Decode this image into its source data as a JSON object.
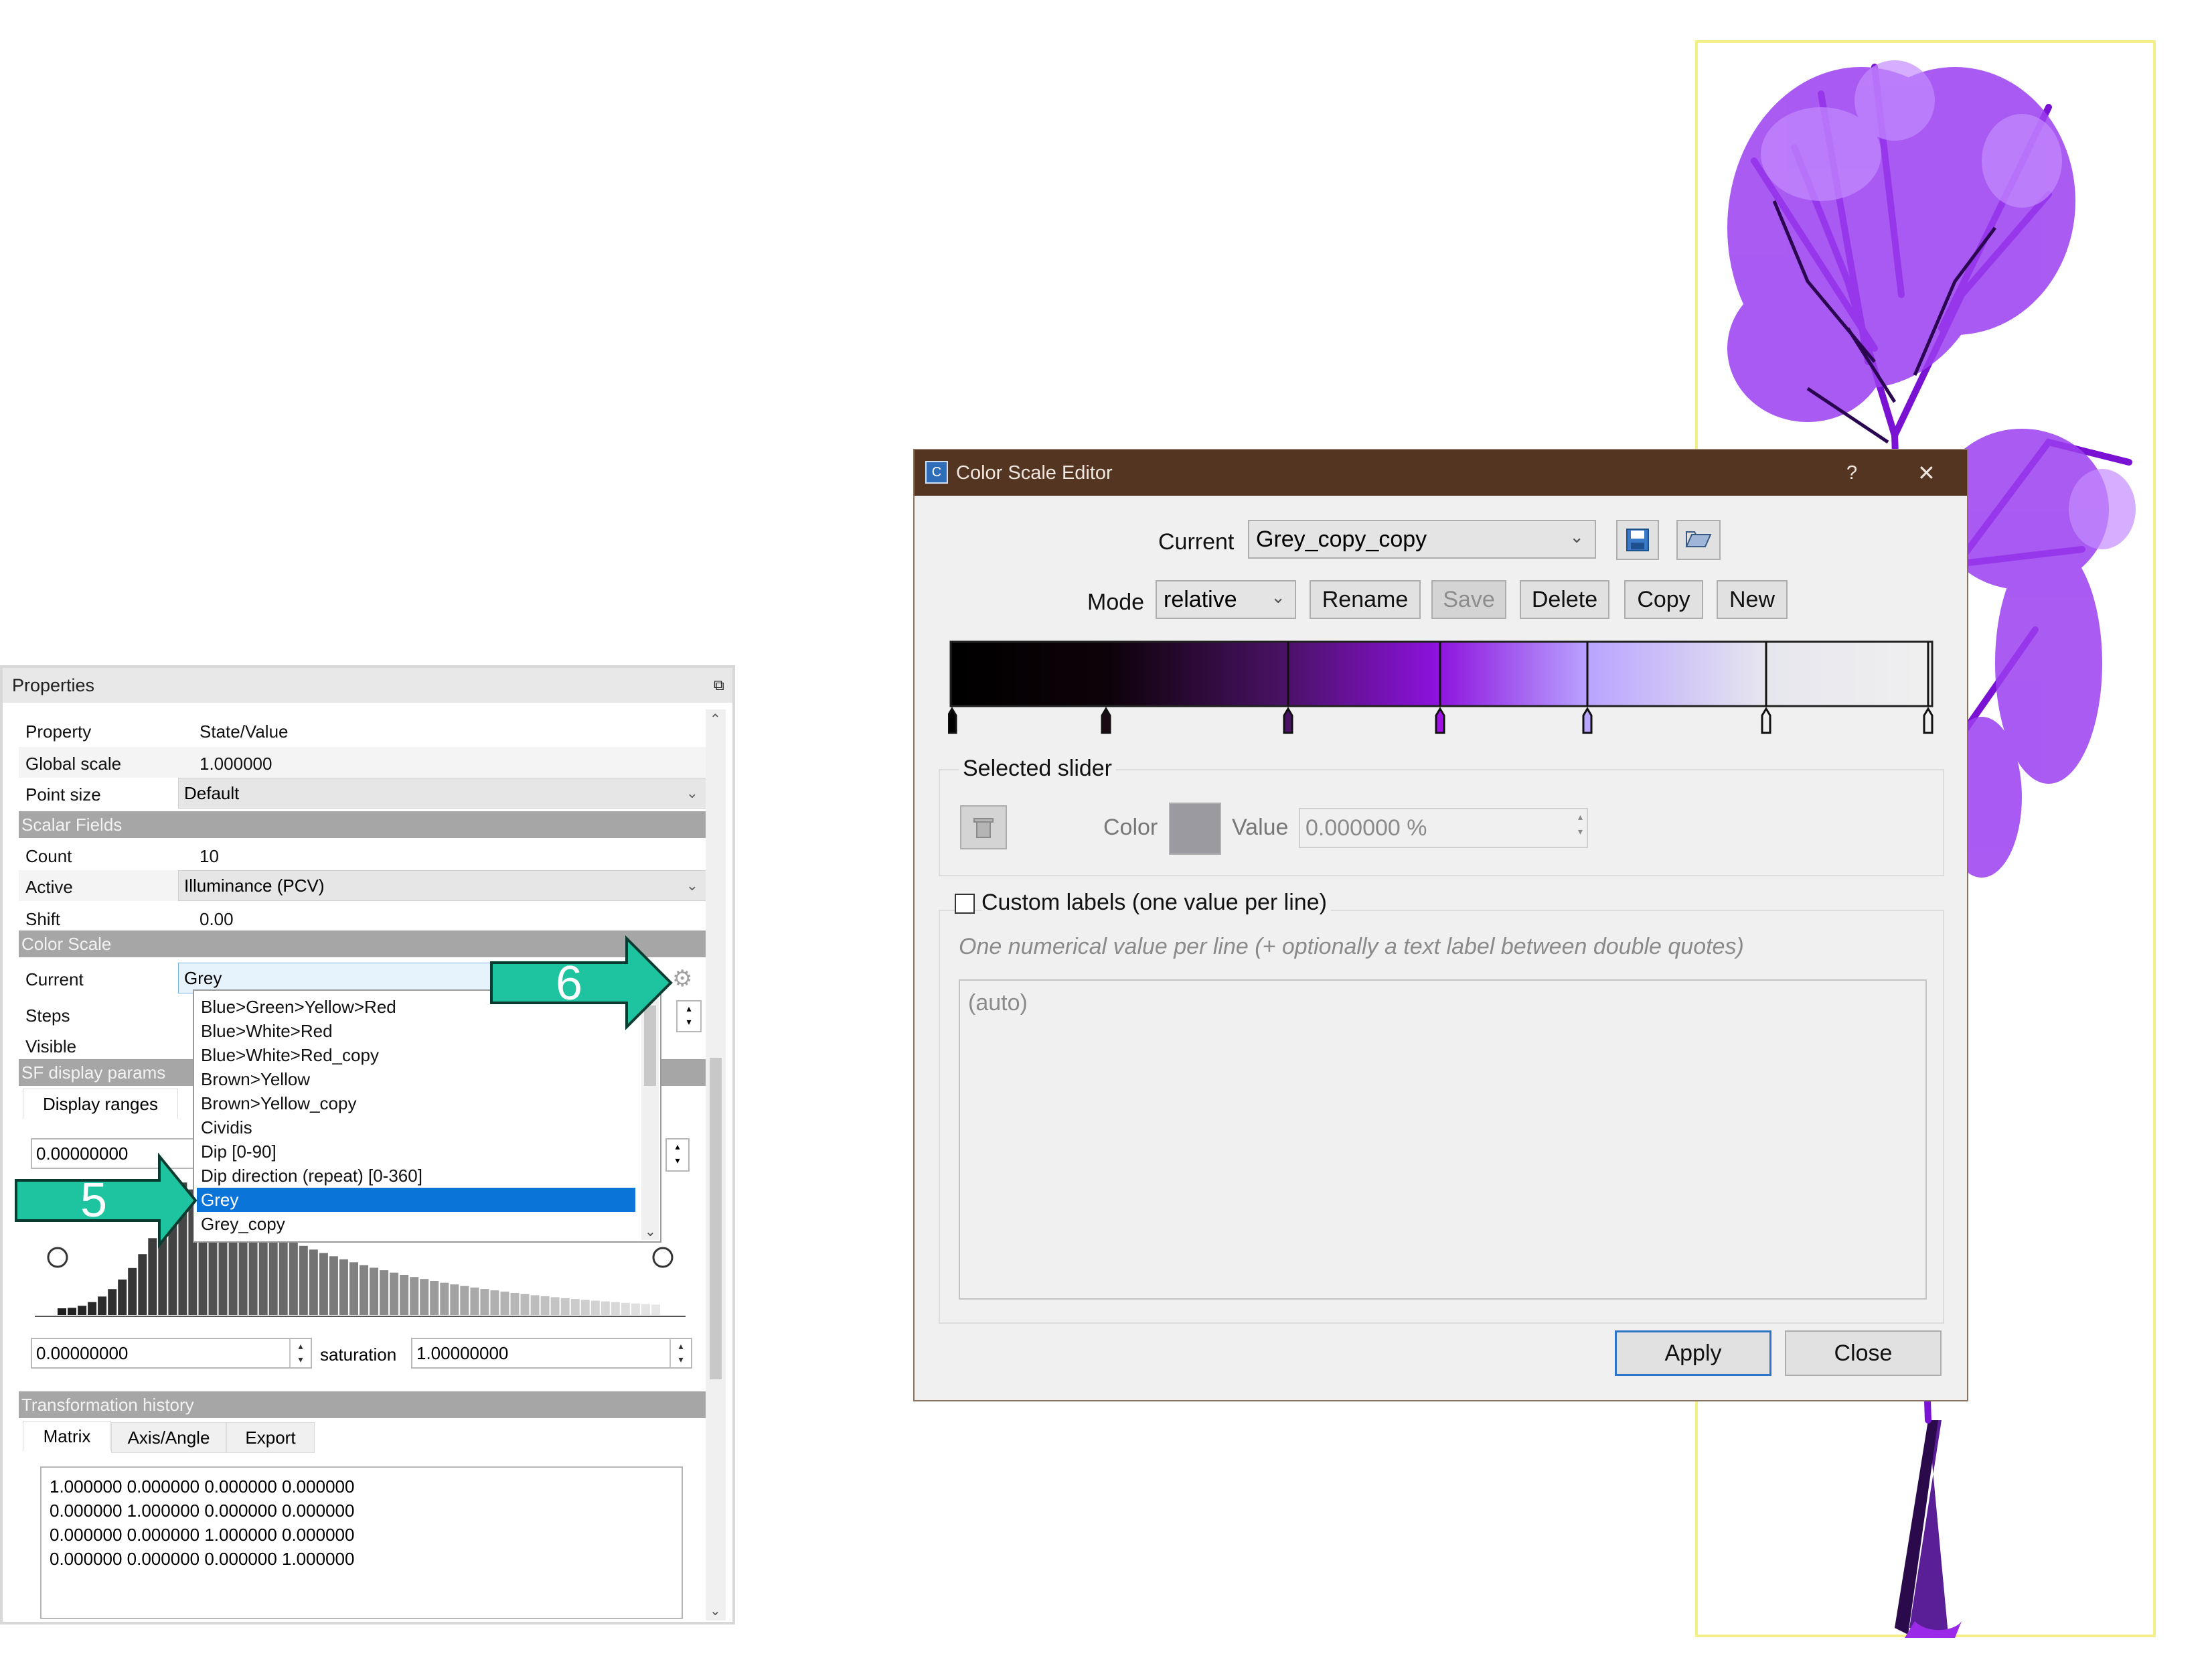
{
  "properties": {
    "title": "Properties",
    "header": {
      "property": "Property",
      "value": "State/Value"
    },
    "global_scale": {
      "label": "Global scale",
      "value": "1.000000"
    },
    "point_size": {
      "label": "Point size",
      "value": "Default"
    },
    "scalar_fields": {
      "section": "Scalar Fields",
      "count": {
        "label": "Count",
        "value": "10"
      },
      "active": {
        "label": "Active",
        "value": "Illuminance (PCV)"
      },
      "shift": {
        "label": "Shift",
        "value": "0.00"
      }
    },
    "color_scale": {
      "section": "Color Scale",
      "current": {
        "label": "Current",
        "value": "Grey"
      },
      "steps": {
        "label": "Steps"
      },
      "visible": {
        "label": "Visible"
      }
    },
    "sf_display": {
      "section": "SF display params",
      "tab": "Display ranges",
      "min_value": "0.00000000",
      "low_value": "0.00000000",
      "saturation_label": "saturation",
      "saturation_value": "1.00000000"
    },
    "transformation": {
      "section": "Transformation history",
      "tabs": [
        "Matrix",
        "Axis/Angle",
        "Export"
      ],
      "matrix": [
        "1.000000 0.000000 0.000000 0.000000",
        "0.000000 1.000000 0.000000 0.000000",
        "0.000000 0.000000 1.000000 0.000000",
        "0.000000 0.000000 0.000000 1.000000"
      ]
    },
    "dropdown_items": [
      "Blue>Green>Yellow>Red",
      "Blue>White>Red",
      "Blue>White>Red_copy",
      "Brown>Yellow",
      "Brown>Yellow_copy",
      "Cividis",
      "Dip [0-90]",
      "Dip direction (repeat) [0-360]",
      "Grey",
      "Grey_copy"
    ],
    "dropdown_selected": "Grey"
  },
  "annotations": {
    "arrow5": "5",
    "arrow6": "6",
    "arrow_color": "#1ec4a0"
  },
  "dialog": {
    "title": "Color Scale Editor",
    "help": "?",
    "close": "✕",
    "current_label": "Current",
    "current_value": "Grey_copy_copy",
    "mode_label": "Mode",
    "mode_value": "relative",
    "buttons": {
      "rename": "Rename",
      "save": "Save",
      "delete": "Delete",
      "copy": "Copy",
      "new": "New"
    },
    "selected_slider": {
      "title": "Selected slider",
      "color_label": "Color",
      "value_label": "Value",
      "value": "0.000000 %"
    },
    "custom_labels": {
      "checkbox": "Custom labels (one value per line)",
      "hint": "One numerical value per line (+ optionally a text label between double quotes)",
      "placeholder": "(auto)"
    },
    "apply": "Apply",
    "close_button": "Close"
  },
  "colors": {
    "dialog_title_bar": "#543522",
    "accent": "#0a74d8",
    "tree": "#8a1fe0"
  }
}
